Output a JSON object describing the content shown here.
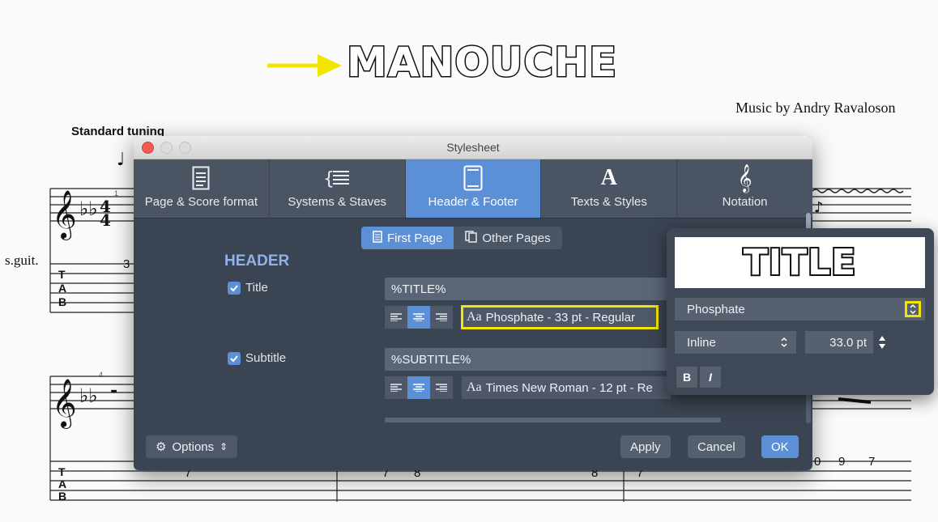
{
  "score": {
    "title": "MANOUCHE",
    "composer": "Music by Andry Ravaloson",
    "tuning": "Standard tuning",
    "instrument": "s.guit.",
    "measure_numbers": [
      "1",
      "4"
    ],
    "tab_numbers": [
      "3",
      "7",
      "7",
      "8",
      "8",
      "7",
      "0",
      "9",
      "7"
    ],
    "arrow_color": "#f2e600"
  },
  "dialog": {
    "title": "Stylesheet",
    "tabs": [
      {
        "label": "Page & Score format",
        "icon": "page-icon"
      },
      {
        "label": "Systems & Staves",
        "icon": "systems-icon"
      },
      {
        "label": "Header & Footer",
        "icon": "header-footer-icon"
      },
      {
        "label": "Texts & Styles",
        "icon": "text-a-icon"
      },
      {
        "label": "Notation",
        "icon": "treble-clef-icon"
      }
    ],
    "segments": {
      "first": "First Page",
      "other": "Other Pages"
    },
    "section": "HEADER",
    "title_row": {
      "label": "Title",
      "value": "%TITLE%",
      "font": "Phosphate - 33 pt - Regular",
      "aa": "Aa"
    },
    "subtitle_row": {
      "label": "Subtitle",
      "value": "%SUBTITLE%",
      "font": "Times New Roman - 12 pt - Re",
      "aa": "Aa"
    },
    "options": "Options",
    "apply": "Apply",
    "cancel": "Cancel",
    "ok": "OK",
    "accent": "#5b8fd6",
    "highlight": "#f2e600"
  },
  "popover": {
    "preview": "TITLE",
    "font": "Phosphate",
    "mode": "Inline",
    "size": "33.0 pt",
    "bold": "B",
    "italic": "I"
  }
}
